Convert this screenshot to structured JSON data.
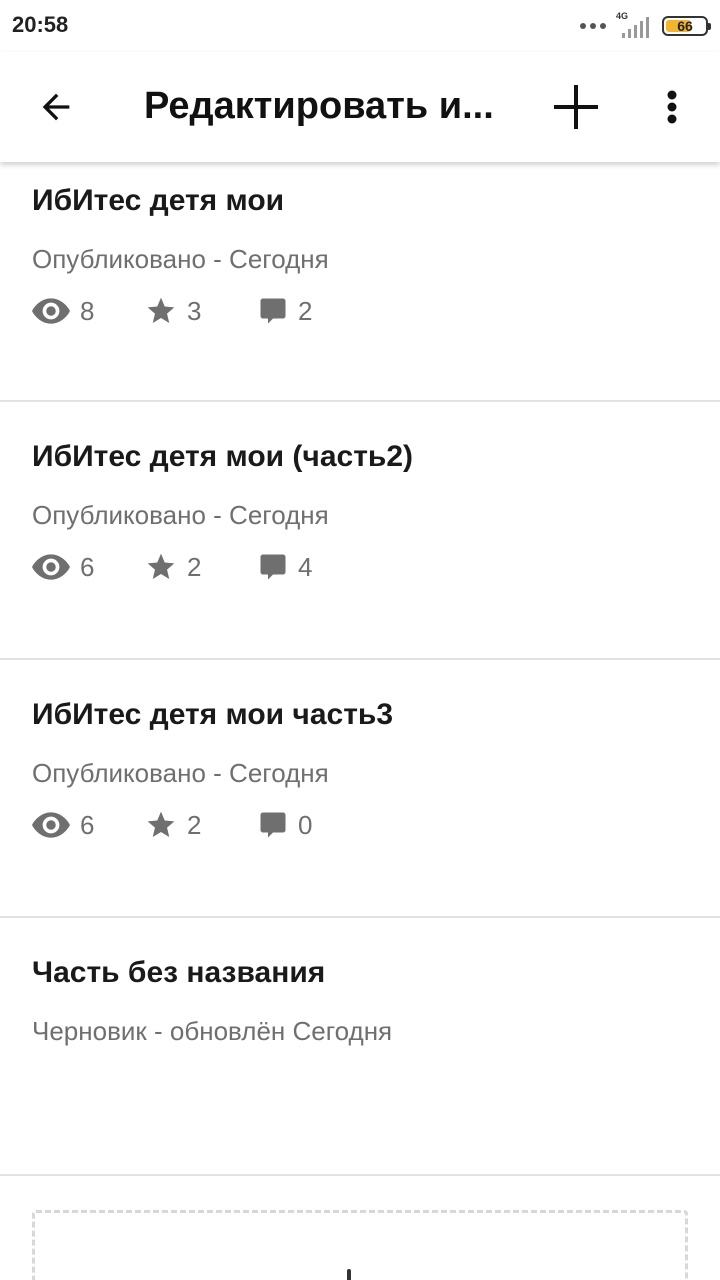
{
  "status_bar": {
    "time": "20:58",
    "network": "4G",
    "battery": "66",
    "battery_level": 0.66
  },
  "app_bar": {
    "title": "Редактировать и...",
    "back_icon": "arrow-back-icon",
    "add_icon": "plus-icon",
    "more_icon": "more-vert-icon"
  },
  "parts": [
    {
      "title": "ИбИтес детя мои",
      "status": "Опубликовано - Сегодня",
      "views": "8",
      "votes": "3",
      "comments": "2"
    },
    {
      "title": "ИбИтес детя мои (часть2)",
      "status": "Опубликовано - Сегодня",
      "views": "6",
      "votes": "2",
      "comments": "4"
    },
    {
      "title": "ИбИтес детя мои часть3",
      "status": "Опубликовано - Сегодня",
      "views": "6",
      "votes": "2",
      "comments": "0"
    },
    {
      "title": "Часть без названия",
      "status": "Черновик - обновлён Сегодня"
    }
  ],
  "colors": {
    "meta_gray": "#6f6f6f",
    "divider": "#e2e2e2",
    "battery_accent": "#f3b52d"
  }
}
